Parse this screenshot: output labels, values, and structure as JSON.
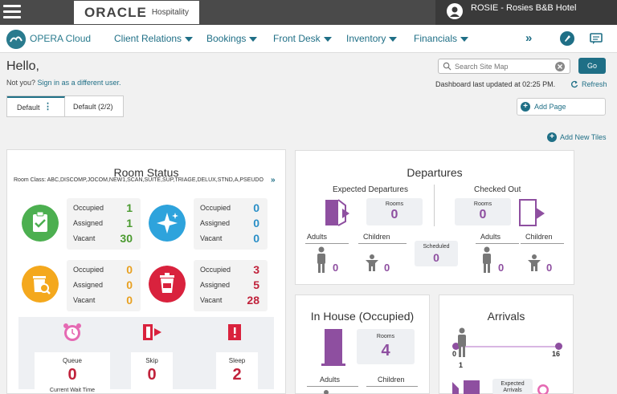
{
  "header": {
    "logo_main": "ORACLE",
    "logo_sub": "Hospitality",
    "user_label": "ROSIE - Rosies B&B Hotel"
  },
  "nav": {
    "brand": "OPERA Cloud",
    "items": [
      {
        "label": "Client Relations"
      },
      {
        "label": "Bookings"
      },
      {
        "label": "Front Desk"
      },
      {
        "label": "Inventory"
      },
      {
        "label": "Financials"
      }
    ],
    "more": "»"
  },
  "greeting": {
    "hello": "Hello,",
    "not_you": "Not you?",
    "sign_in_link": "Sign in as a different user."
  },
  "search": {
    "placeholder": "Search Site Map",
    "go_label": "Go"
  },
  "dashboard": {
    "updated": "Dashboard last updated at 02:25 PM.",
    "refresh_label": "Refresh",
    "tabs": [
      {
        "label": "Default"
      },
      {
        "label": "Default (2/2)"
      }
    ],
    "add_page": "Add Page",
    "add_tiles": "Add New Tiles"
  },
  "room_status": {
    "title": "Room Status",
    "room_class": "Room Class: ABC,DISCOMP,JOCOM,NEW1,SCAN,SUITE,SUP,TRIAGE,DELUX,STND,A,PSEUDO",
    "groups": [
      {
        "color": "#4caf50",
        "icon": "clipboard-check-icon",
        "rows": [
          {
            "label": "Occupied",
            "value": "1"
          },
          {
            "label": "Assigned",
            "value": "1"
          },
          {
            "label": "Vacant",
            "value": "30"
          }
        ],
        "value_color": "#4a9a2f"
      },
      {
        "color": "#2ea3dc",
        "icon": "sparkle-icon",
        "rows": [
          {
            "label": "Occupied",
            "value": "0"
          },
          {
            "label": "Assigned",
            "value": "0"
          },
          {
            "label": "Vacant",
            "value": "0"
          }
        ],
        "value_color": "#2a8fc7"
      },
      {
        "color": "#f4a81d",
        "icon": "inspect-bin-icon",
        "rows": [
          {
            "label": "Occupied",
            "value": "0"
          },
          {
            "label": "Assigned",
            "value": "0"
          },
          {
            "label": "Vacant",
            "value": "0"
          }
        ],
        "value_color": "#e8a020"
      },
      {
        "color": "#d9223d",
        "icon": "trash-bin-icon",
        "rows": [
          {
            "label": "Occupied",
            "value": "3"
          },
          {
            "label": "Assigned",
            "value": "5"
          },
          {
            "label": "Vacant",
            "value": "28"
          }
        ],
        "value_color": "#c0223b"
      }
    ],
    "queue": {
      "label": "Queue",
      "value": "0",
      "sub": "Current Wait Time"
    },
    "skip": {
      "label": "Skip",
      "value": "0"
    },
    "sleep": {
      "label": "Sleep",
      "value": "2"
    }
  },
  "departures": {
    "title": "Departures",
    "expected_label": "Expected Departures",
    "checked_out_label": "Checked Out",
    "rooms_label": "Rooms",
    "expected_rooms": "0",
    "checked_out_rooms": "0",
    "adults_label": "Adults",
    "children_label": "Children",
    "expected_adults": "0",
    "expected_children": "0",
    "checked_adults": "0",
    "checked_children": "0",
    "scheduled_label": "Scheduled",
    "scheduled_value": "0"
  },
  "in_house": {
    "title": "In House (Occupied)",
    "rooms_label": "Rooms",
    "rooms_value": "4",
    "adults_label": "Adults",
    "children_label": "Children"
  },
  "arrivals": {
    "title": "Arrivals",
    "range_min": "0",
    "range_max": "16",
    "current": "1",
    "expected_label": "Expected Arrivals"
  }
}
